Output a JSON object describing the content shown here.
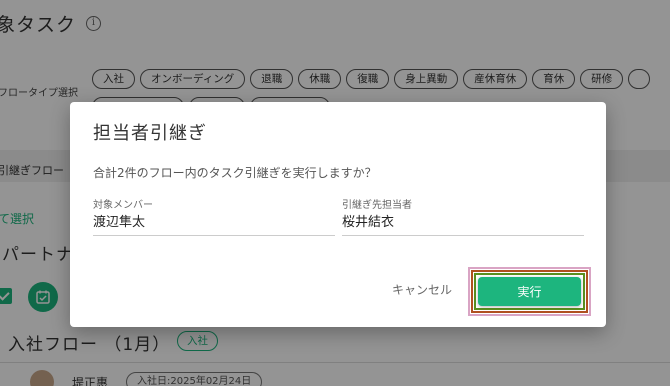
{
  "background": {
    "page_title": "象タスク",
    "flow_type_label": "フロータイプ選択",
    "flow_types_row1": [
      "入社",
      "オンボーディング",
      "退職",
      "休職",
      "復職",
      "身上異動",
      "産休育休",
      "育休",
      "研修",
      ""
    ],
    "flow_types_row2": [
      "",
      "",
      ""
    ],
    "section_bar_text": "引継ぎフロー",
    "select_link": "て選択",
    "partner_heading": "パートナ",
    "flow_title": "入社フロー （1月）",
    "flow_badge": "入社",
    "row_name": "堤正惠",
    "row_chip": "入社日:2025年02月24日"
  },
  "dialog": {
    "title": "担当者引継ぎ",
    "message": "合計2件のフロー内のタスク引継ぎを実行しますか？",
    "member_label": "対象メンバー",
    "member_value": "渡辺隼太",
    "assignee_label": "引継ぎ先担当者",
    "assignee_value": "桜井結衣",
    "cancel_label": "キャンセル",
    "execute_label": "実行"
  },
  "colors": {
    "accent": "#1db57e",
    "overlay": "rgba(0,0,0,0.42)"
  },
  "icons": {
    "info": "info-icon",
    "check": "checkbox-checked-icon",
    "calendar": "calendar-check-icon"
  }
}
